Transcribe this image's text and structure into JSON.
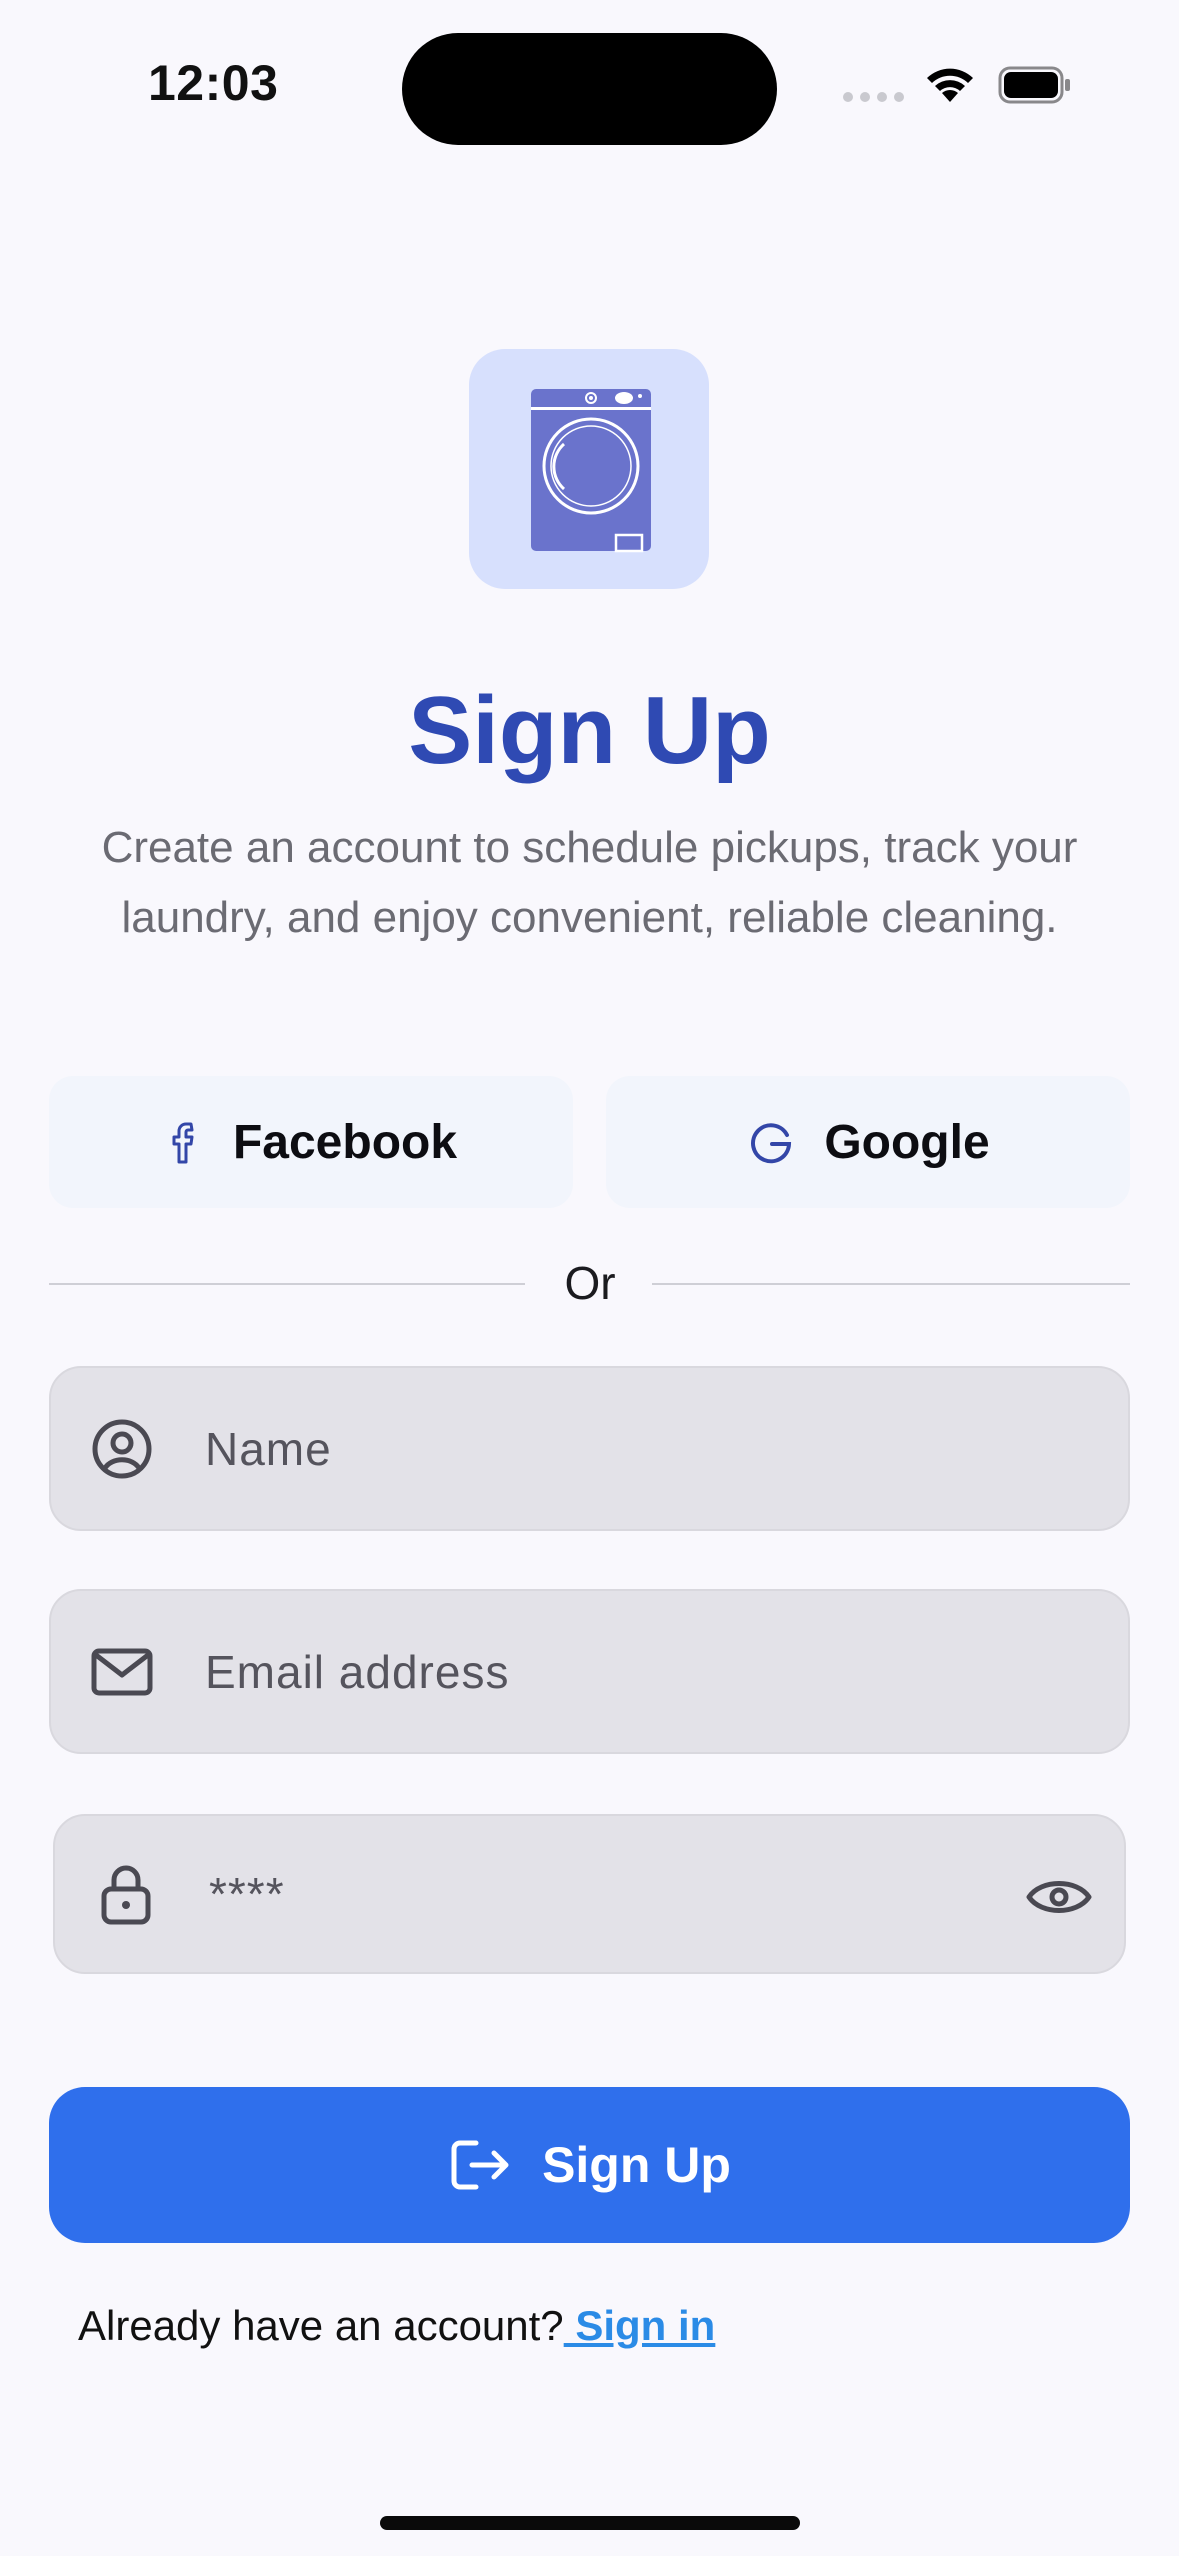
{
  "status_bar": {
    "time": "12:03"
  },
  "header": {
    "title": "Sign Up",
    "subtitle": "Create an account to schedule pickups, track your laundry, and enjoy convenient, reliable cleaning."
  },
  "social": {
    "facebook_label": "Facebook",
    "google_label": "Google"
  },
  "divider_label": "Or",
  "form": {
    "name_placeholder": "Name",
    "email_placeholder": "Email address",
    "password_value": "****"
  },
  "primary_button": {
    "label": "Sign Up"
  },
  "footer": {
    "prompt": "Already have an account?",
    "link": " Sign in"
  },
  "colors": {
    "brand": "#2f4ab3",
    "primary": "#2f6fec",
    "link": "#2b8be6",
    "logo_bg": "#d7e0fd",
    "washer": "#6a73cc"
  },
  "icons": [
    "wifi-icon",
    "battery-icon",
    "washing-machine-icon",
    "facebook-icon",
    "google-icon",
    "user-icon",
    "mail-icon",
    "lock-icon",
    "eye-icon",
    "sign-in-icon"
  ]
}
